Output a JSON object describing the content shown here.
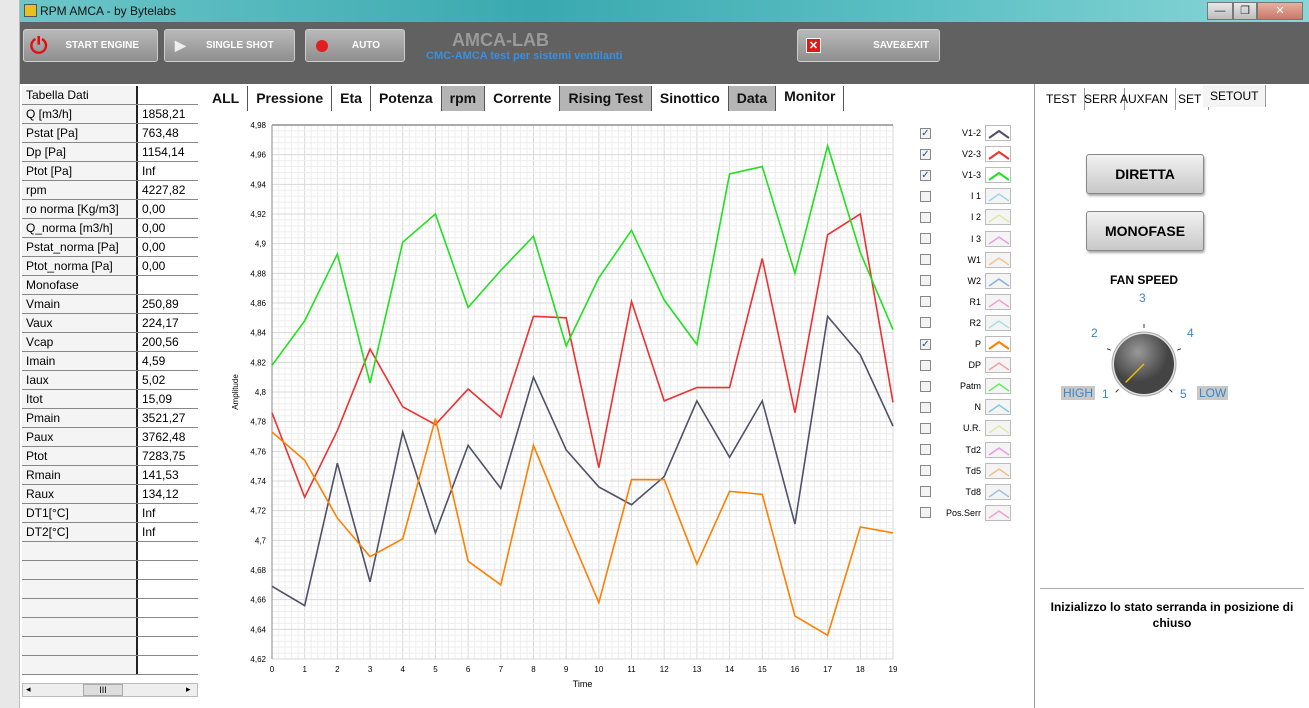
{
  "window": {
    "title": "RPM AMCA - by Bytelabs",
    "min": "—",
    "restore": "❐",
    "close": "✕"
  },
  "toolbar": {
    "start_engine": "START ENGINE",
    "single_shot": "SINGLE SHOT",
    "auto": "AUTO",
    "brand": "AMCA-LAB",
    "brand_sub": "CMC-AMCA test per sistemi ventilanti",
    "save_exit": "SAVE&EXIT"
  },
  "table": {
    "rows": [
      [
        "Tabella Dati",
        ""
      ],
      [
        "Q [m3/h]",
        "1858,21"
      ],
      [
        "Pstat [Pa]",
        "763,48"
      ],
      [
        "Dp [Pa]",
        "1154,14"
      ],
      [
        "Ptot [Pa]",
        "Inf"
      ],
      [
        "rpm",
        "4227,82"
      ],
      [
        "ro norma [Kg/m3]",
        "0,00"
      ],
      [
        "Q_norma [m3/h]",
        "0,00"
      ],
      [
        "Pstat_norma [Pa]",
        "0,00"
      ],
      [
        "Ptot_norma [Pa]",
        "0,00"
      ],
      [
        "Monofase",
        ""
      ],
      [
        "Vmain",
        "250,89"
      ],
      [
        "Vaux",
        "224,17"
      ],
      [
        "Vcap",
        "200,56"
      ],
      [
        "Imain",
        "4,59"
      ],
      [
        "Iaux",
        "5,02"
      ],
      [
        "Itot",
        "15,09"
      ],
      [
        "Pmain",
        "3521,27"
      ],
      [
        "Paux",
        "3762,48"
      ],
      [
        "Ptot",
        "7283,75"
      ],
      [
        "Rmain",
        "141,53"
      ],
      [
        "Raux",
        "134,12"
      ],
      [
        "DT1[°C]",
        "Inf"
      ],
      [
        "DT2[°C]",
        "Inf"
      ],
      [
        "",
        ""
      ],
      [
        "",
        ""
      ],
      [
        "",
        ""
      ],
      [
        "",
        ""
      ],
      [
        "",
        ""
      ],
      [
        "",
        ""
      ],
      [
        "",
        ""
      ]
    ],
    "scroll_label": "III"
  },
  "tabs": [
    {
      "label": "ALL",
      "style": "white"
    },
    {
      "label": "Pressione",
      "style": "white"
    },
    {
      "label": "Eta",
      "style": "white"
    },
    {
      "label": "Potenza",
      "style": "white"
    },
    {
      "label": "rpm",
      "style": "gray"
    },
    {
      "label": "Corrente",
      "style": "white"
    },
    {
      "label": "Rising Test",
      "style": "gray"
    },
    {
      "label": "Sinottico",
      "style": "white"
    },
    {
      "label": "Data",
      "style": "gray"
    },
    {
      "label": "Monitor",
      "style": "selected"
    }
  ],
  "chart_data": {
    "type": "line",
    "xlabel": "Time",
    "ylabel": "Amplitude",
    "xlim": [
      0,
      19
    ],
    "ylim": [
      4.62,
      4.98
    ],
    "x": [
      0,
      1,
      2,
      3,
      4,
      5,
      6,
      7,
      8,
      9,
      10,
      11,
      12,
      13,
      14,
      15,
      16,
      17,
      18,
      19
    ],
    "yticks": [
      "4,62",
      "4,64",
      "4,66",
      "4,68",
      "4,7",
      "4,72",
      "4,74",
      "4,76",
      "4,78",
      "4,8",
      "4,82",
      "4,84",
      "4,86",
      "4,88",
      "4,9",
      "4,92",
      "4,94",
      "4,96",
      "4,98"
    ],
    "grid": true,
    "legend": "right",
    "series": [
      {
        "name": "V1-2",
        "color": "#505068",
        "values": [
          4.669,
          4.656,
          4.752,
          4.672,
          4.773,
          4.705,
          4.764,
          4.735,
          4.81,
          4.761,
          4.736,
          4.724,
          4.743,
          4.794,
          4.756,
          4.794,
          4.711,
          4.851,
          4.825,
          4.777
        ]
      },
      {
        "name": "V2-3",
        "color": "#f03030",
        "values": [
          4.786,
          4.729,
          4.774,
          4.829,
          4.79,
          4.778,
          4.802,
          4.783,
          4.851,
          4.85,
          4.749,
          4.861,
          4.794,
          4.803,
          4.803,
          4.89,
          4.786,
          4.906,
          4.92,
          4.793
        ]
      },
      {
        "name": "V1-3",
        "color": "#20e020",
        "values": [
          4.818,
          4.848,
          4.893,
          4.806,
          4.901,
          4.92,
          4.857,
          4.882,
          4.905,
          4.831,
          4.877,
          4.909,
          4.862,
          4.832,
          4.947,
          4.952,
          4.88,
          4.966,
          4.894,
          4.842
        ]
      },
      {
        "name": "P",
        "color": "#ff7f00",
        "values": [
          4.773,
          4.754,
          4.715,
          4.689,
          4.701,
          4.782,
          4.686,
          4.67,
          4.764,
          4.71,
          4.658,
          4.741,
          4.741,
          4.684,
          4.733,
          4.731,
          4.649,
          4.636,
          4.709,
          4.705
        ]
      }
    ]
  },
  "legend": [
    {
      "name": "V1-2",
      "checked": true,
      "color": "#505068"
    },
    {
      "name": "V2-3",
      "checked": true,
      "color": "#f03030"
    },
    {
      "name": "V1-3",
      "checked": true,
      "color": "#20e020"
    },
    {
      "name": "I 1",
      "checked": false,
      "color": "#9fd4f0"
    },
    {
      "name": "I 2",
      "checked": false,
      "color": "#dde8a8"
    },
    {
      "name": "I 3",
      "checked": false,
      "color": "#e8a0e0"
    },
    {
      "name": "W1",
      "checked": false,
      "color": "#f4c48c"
    },
    {
      "name": "W2",
      "checked": false,
      "color": "#8cb0d8"
    },
    {
      "name": "R1",
      "checked": false,
      "color": "#f0a0d0"
    },
    {
      "name": "R2",
      "checked": false,
      "color": "#a8e0e8"
    },
    {
      "name": "P",
      "checked": true,
      "color": "#ff7f00"
    },
    {
      "name": "DP",
      "checked": false,
      "color": "#f0a0a0"
    },
    {
      "name": "Patm",
      "checked": false,
      "color": "#60f060"
    },
    {
      "name": "N",
      "checked": false,
      "color": "#80c8f0"
    },
    {
      "name": "U.R.",
      "checked": false,
      "color": "#e0eaa8"
    },
    {
      "name": "Td2",
      "checked": false,
      "color": "#e898e0"
    },
    {
      "name": "Td5",
      "checked": false,
      "color": "#f8c080"
    },
    {
      "name": "Td8",
      "checked": false,
      "color": "#a0c0e8"
    },
    {
      "name": "Pos.Serr",
      "checked": false,
      "color": "#f0a0d0"
    }
  ],
  "right": {
    "tabs": [
      "TEST",
      "SERR",
      "AUXFAN",
      "SET",
      "SETOUT"
    ],
    "selected_tab": "SETOUT",
    "diretta": "DIRETTA",
    "monofase": "MONOFASE",
    "fan_speed_label": "FAN SPEED",
    "knob_labels": [
      "1",
      "2",
      "3",
      "4",
      "5"
    ],
    "high": "HIGH",
    "low": "LOW",
    "fan_speed_value": 1,
    "message": "Inizializzo lo stato serranda in posizione di chiuso"
  }
}
